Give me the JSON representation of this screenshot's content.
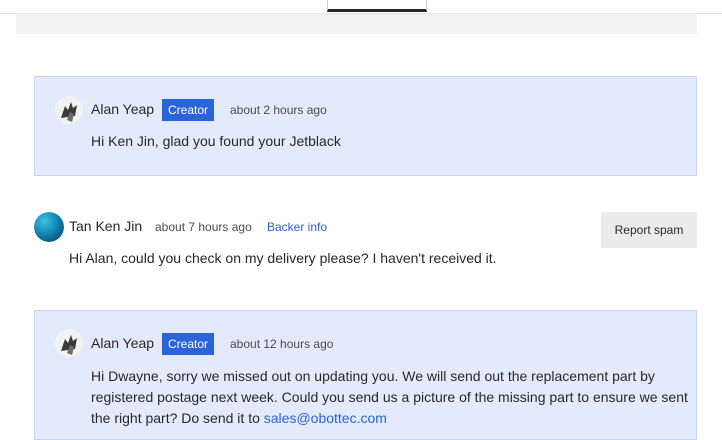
{
  "comments": [
    {
      "author": "Alan Yeap",
      "badge": "Creator",
      "time": "about 2 hours ago",
      "text": "Hi Ken Jin, glad you found your Jetblack"
    },
    {
      "author": "Tan Ken Jin",
      "time": "about 7 hours ago",
      "backer_link": "Backer info",
      "report_label": "Report spam",
      "text": "Hi Alan, could you check on my delivery please? I haven't received it."
    },
    {
      "author": "Alan Yeap",
      "badge": "Creator",
      "time": "about 12 hours ago",
      "text": "Hi Dwayne, sorry we missed out on updating you. We will send out the replacement part by registered postage next week. Could you send us a picture of the missing part to ensure we sent the right part? Do send it to ",
      "email": "sales@obottec.com"
    }
  ],
  "colors": {
    "creator_bg": "#e3eafb",
    "badge": "#2b63d8",
    "link": "#2b63d8",
    "spam_button": "#ebebeb"
  }
}
